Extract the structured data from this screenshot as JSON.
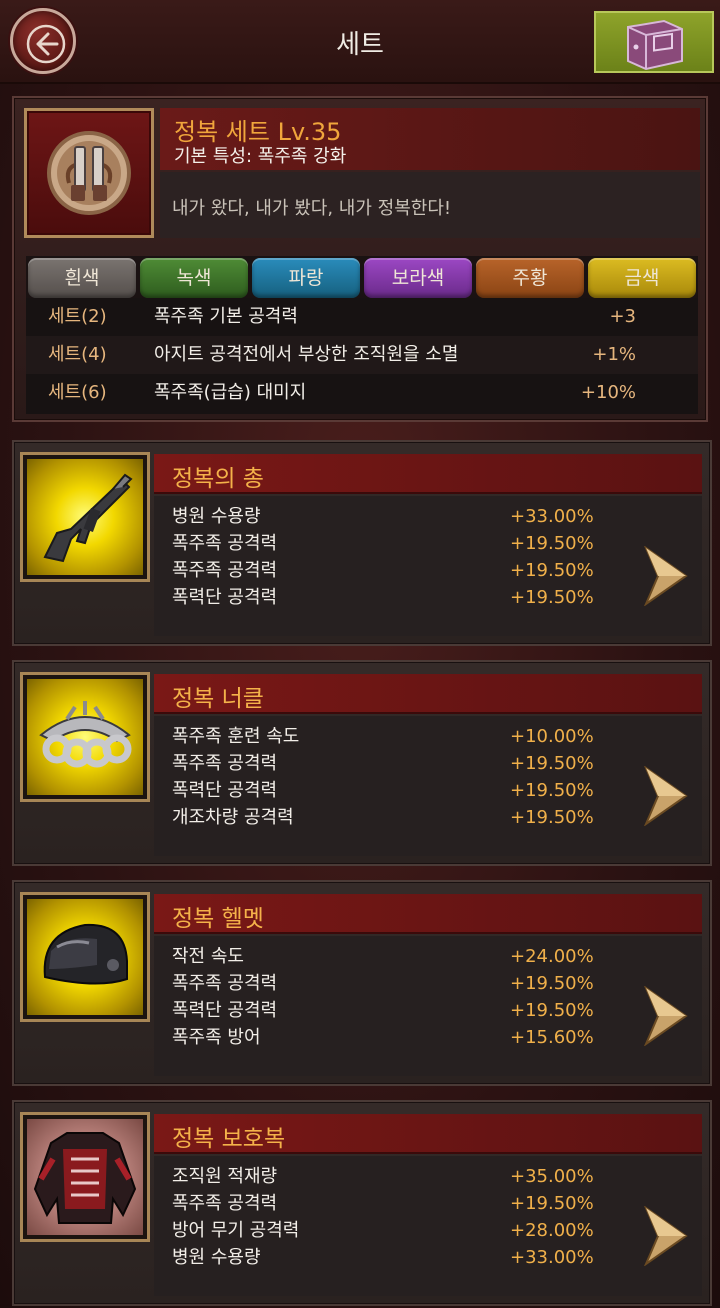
{
  "header": {
    "title": "세트",
    "back_icon": "back-arrow-icon",
    "chest_icon": "storage-chest-icon"
  },
  "set": {
    "title": "정복 세트 Lv.35",
    "trait": "기본 특성: 폭주족 강화",
    "description": "내가 왔다, 내가 봤다, 내가 정복한다!",
    "grades": [
      {
        "label": "흰색",
        "color": "#6a6460"
      },
      {
        "label": "녹색",
        "color": "#3f7a2a"
      },
      {
        "label": "파랑",
        "color": "#1f7aa6"
      },
      {
        "label": "보라색",
        "color": "#8a3ab0"
      },
      {
        "label": "주황",
        "color": "#a8561e"
      },
      {
        "label": "금색",
        "color": "#c8a614"
      }
    ],
    "bonuses": [
      {
        "set": "세트(2)",
        "desc": "폭주족 기본 공격력",
        "value": "+3"
      },
      {
        "set": "세트(4)",
        "desc": "아지트 공격전에서 부상한 조직원을 소멸",
        "value": "+1%"
      },
      {
        "set": "세트(6)",
        "desc": "폭주족(급습) 대미지",
        "value": "+10%"
      }
    ]
  },
  "items": [
    {
      "title": "정복의 총",
      "icon": "gun-icon",
      "stats": [
        {
          "name": "병원 수용량",
          "value": "+33.00%"
        },
        {
          "name": "폭주족 공격력",
          "value": "+19.50%"
        },
        {
          "name": "폭주족 공격력",
          "value": "+19.50%"
        },
        {
          "name": "폭력단 공격력",
          "value": "+19.50%"
        }
      ]
    },
    {
      "title": "정복 너클",
      "icon": "knuckles-icon",
      "stats": [
        {
          "name": "폭주족 훈련 속도",
          "value": "+10.00%"
        },
        {
          "name": "폭주족 공격력",
          "value": "+19.50%"
        },
        {
          "name": "폭력단 공격력",
          "value": "+19.50%"
        },
        {
          "name": "개조차량 공격력",
          "value": "+19.50%"
        }
      ]
    },
    {
      "title": "정복 헬멧",
      "icon": "helmet-icon",
      "stats": [
        {
          "name": "작전 속도",
          "value": "+24.00%"
        },
        {
          "name": "폭주족 공격력",
          "value": "+19.50%"
        },
        {
          "name": "폭력단 공격력",
          "value": "+19.50%"
        },
        {
          "name": "폭주족 방어",
          "value": "+15.60%"
        }
      ]
    },
    {
      "title": "정복 보호복",
      "icon": "armor-icon",
      "stats": [
        {
          "name": "조직원 적재량",
          "value": "+35.00%"
        },
        {
          "name": "폭주족 공격력",
          "value": "+19.50%"
        },
        {
          "name": "방어 무기 공격력",
          "value": "+28.00%"
        },
        {
          "name": "병원 수용량",
          "value": "+33.00%"
        }
      ]
    }
  ]
}
